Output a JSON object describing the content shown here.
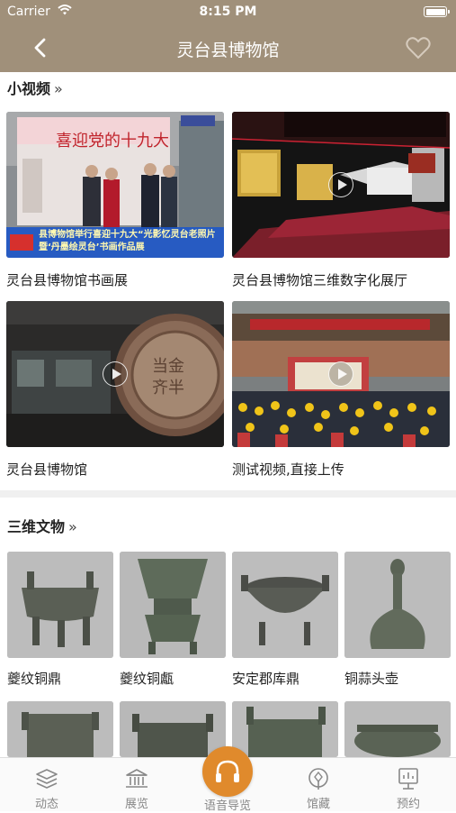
{
  "status_bar": {
    "carrier": "Carrier",
    "time": "8:15 PM"
  },
  "nav": {
    "title": "灵台县博物馆"
  },
  "videos_section": {
    "title": "小视频",
    "chevron": "»",
    "items": [
      {
        "caption": "灵台县博物馆书画展",
        "overlay_text": "县博物馆举行喜迎十九大“光影忆灵台老照片暨‘丹墨绘灵台’书画作品展"
      },
      {
        "caption": "灵台县博物馆三维数字化展厅"
      },
      {
        "caption": "灵台县博物馆"
      },
      {
        "caption": "测试视频,直接上传"
      }
    ]
  },
  "artifacts_section": {
    "title": "三维文物",
    "chevron": "»",
    "items": [
      {
        "caption": "夔纹铜鼎"
      },
      {
        "caption": "夔纹铜甗"
      },
      {
        "caption": "安定郡库鼎"
      },
      {
        "caption": "铜蒜头壶"
      }
    ]
  },
  "tab_bar": {
    "tabs": [
      {
        "label": "动态",
        "icon": "layers-icon"
      },
      {
        "label": "展览",
        "icon": "museum-icon"
      },
      {
        "label": "语音导览",
        "icon": "headphones-icon"
      },
      {
        "label": "馆藏",
        "icon": "collection-icon"
      },
      {
        "label": "预约",
        "icon": "reservation-icon"
      }
    ]
  },
  "colors": {
    "header": "#a0907a",
    "accent": "#e08a2c",
    "tab_text": "#888888"
  }
}
